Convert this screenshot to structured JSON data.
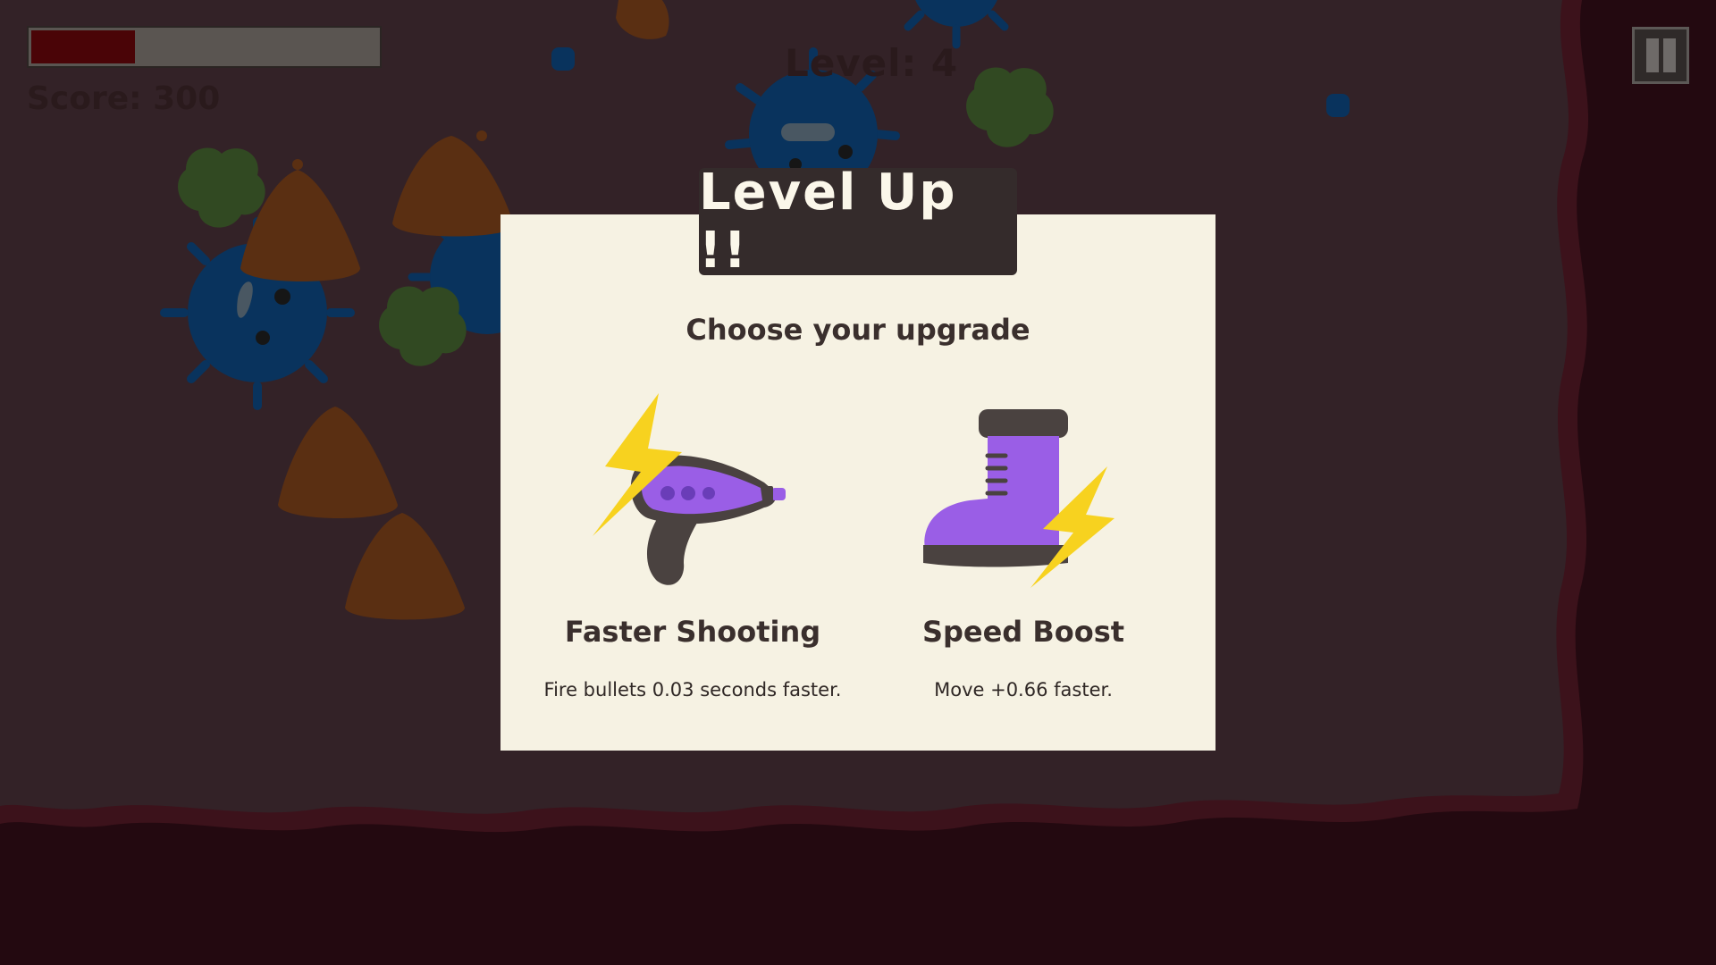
{
  "hud": {
    "health_fraction": 0.3,
    "score_text": "Score: 300",
    "level_text": "Level: 4",
    "pause_icon": "pause-icon"
  },
  "modal": {
    "title": "Level Up !!",
    "subtitle": "Choose your upgrade",
    "options": [
      {
        "icon": "ray-gun-lightning-icon",
        "title": "Faster Shooting",
        "description": "Fire bullets 0.03 seconds faster."
      },
      {
        "icon": "boot-lightning-icon",
        "title": "Speed Boost",
        "description": "Move +0.66 faster."
      }
    ]
  },
  "colors": {
    "arena": "#3f2a30",
    "arena_border": "#4a1621",
    "outside": "#2b0b14",
    "panel": "#f6f2e3",
    "header": "#342b2b",
    "health_fill": "#4a0407",
    "virus_blue": "#0b3f72",
    "virus_orange": "#6e3a16",
    "virus_green": "#3c5a2a",
    "upgrade_purple": "#9a5ee6",
    "lightning": "#f7d21f"
  }
}
